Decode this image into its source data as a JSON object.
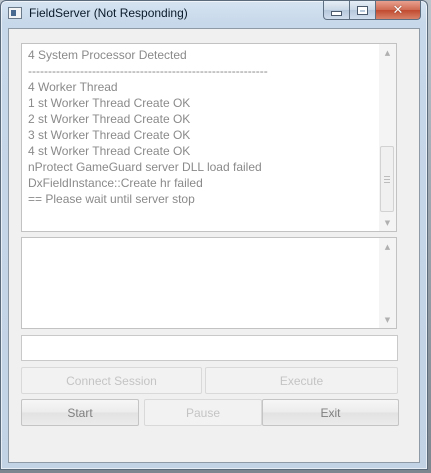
{
  "window": {
    "title": "FieldServer (Not Responding)"
  },
  "log": {
    "lines": [
      "4 System Processor Detected",
      "------------------------------------------------------------",
      "4 Worker Thread",
      "1 st Worker Thread Create OK",
      "2 st Worker Thread Create OK",
      "3 st Worker Thread Create OK",
      "4 st Worker Thread Create OK",
      "nProtect GameGuard server DLL load failed",
      "DxFieldInstance::Create hr failed",
      "== Please wait until server stop"
    ]
  },
  "command_input": {
    "value": ""
  },
  "buttons": {
    "connect_session": "Connect Session",
    "execute": "Execute",
    "start": "Start",
    "pause": "Pause",
    "exit": "Exit"
  },
  "icons": {
    "app": "app-window-icon",
    "minimize": "minimize-icon",
    "maximize": "maximize-icon",
    "close": "close-icon",
    "scroll_up": "scroll-up-arrow-icon",
    "scroll_down": "scroll-down-arrow-icon"
  },
  "colors": {
    "close_button": "#c9533a",
    "log_text": "#8a8a8a",
    "disabled_text": "#c4c4c4"
  }
}
